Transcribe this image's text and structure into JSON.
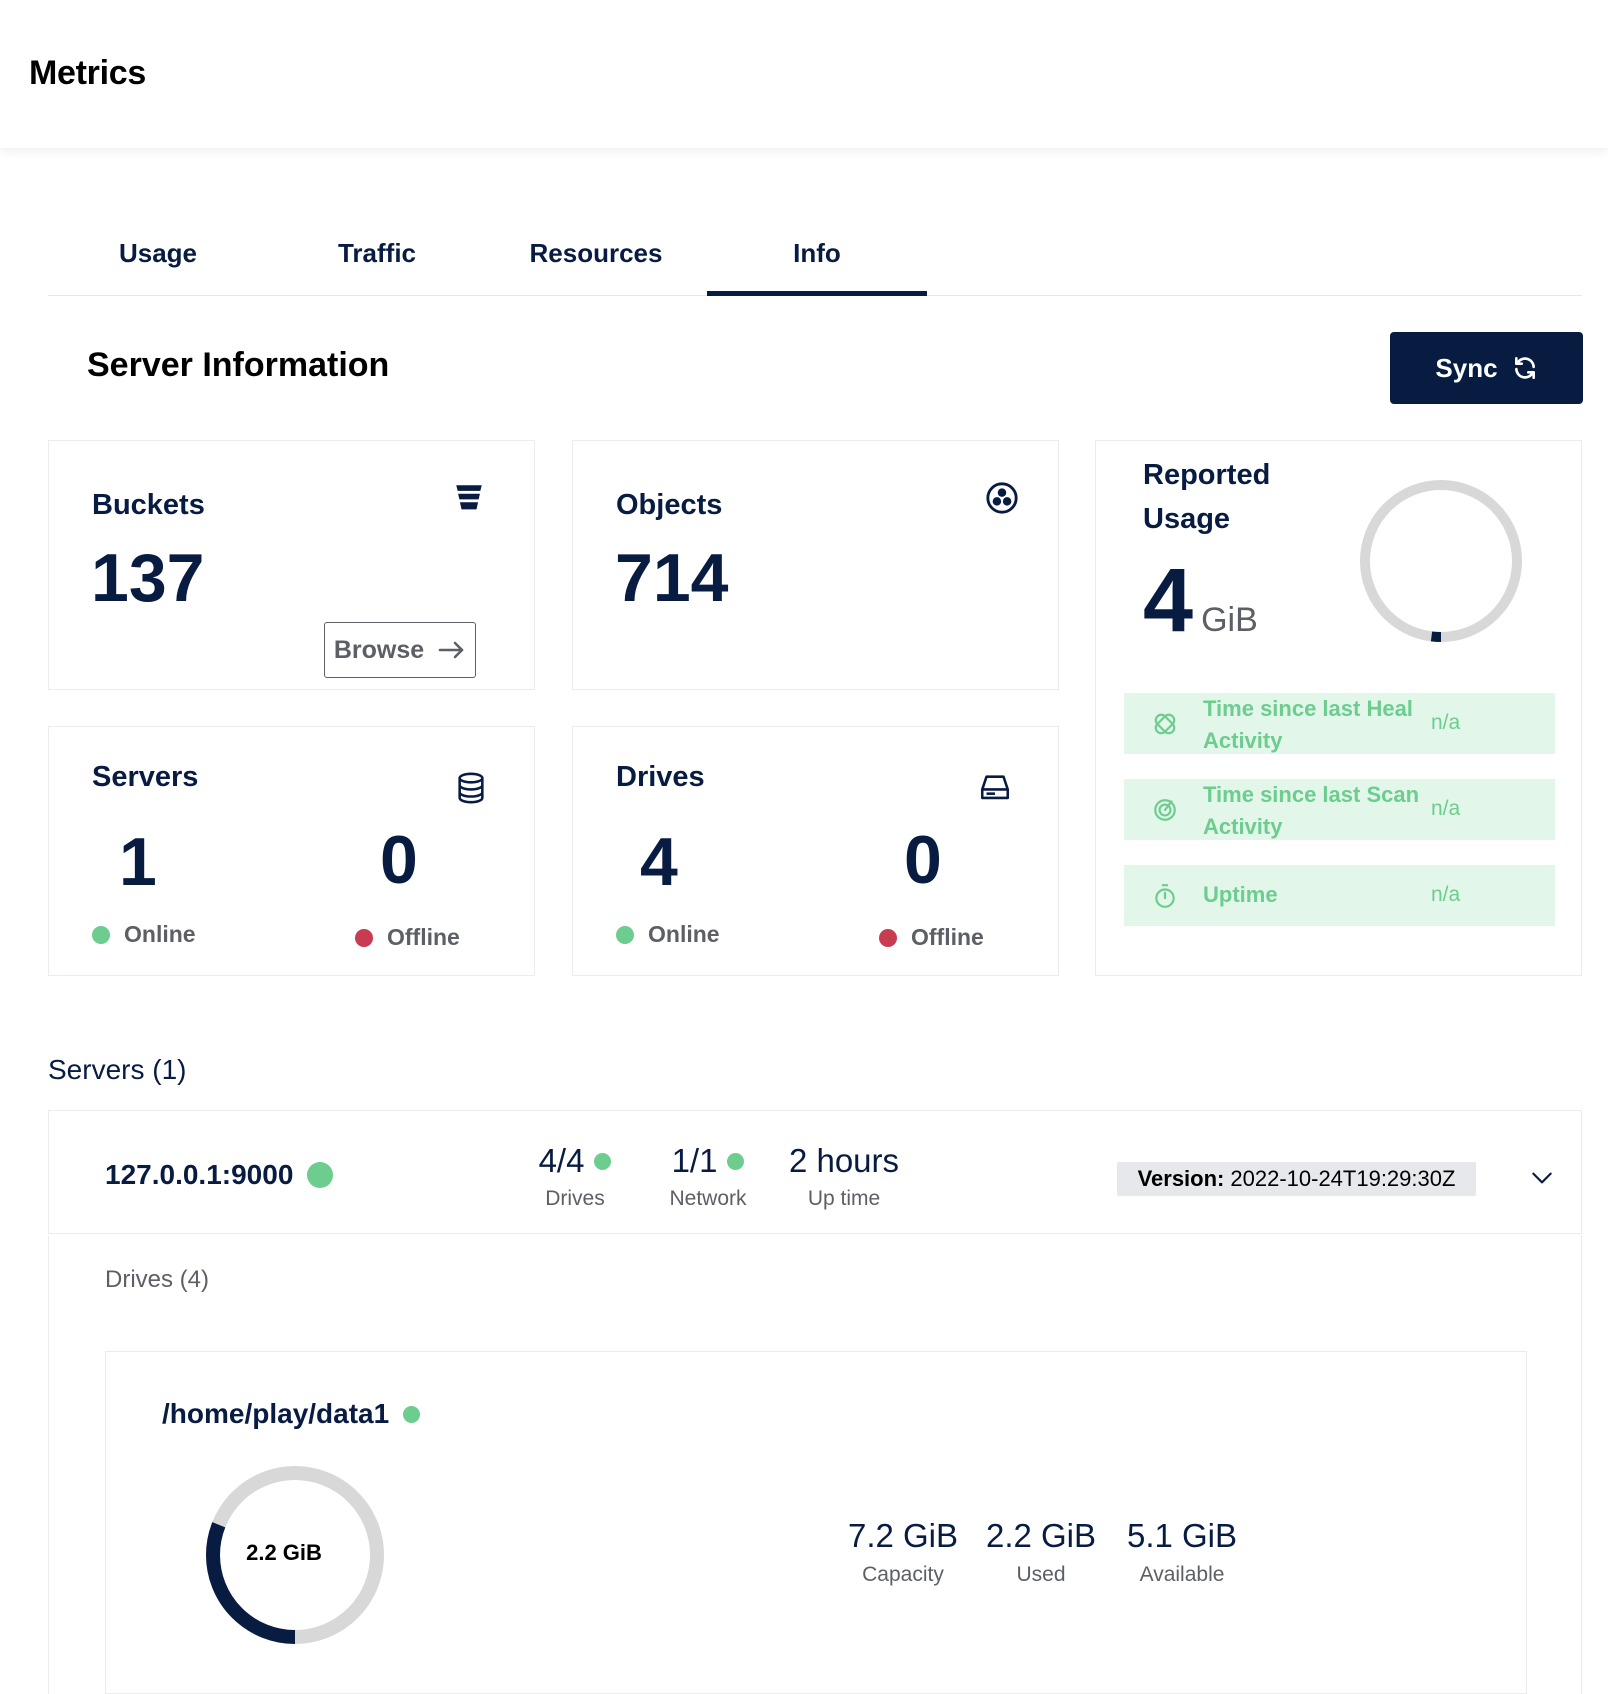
{
  "header": {
    "title": "Metrics"
  },
  "tabs": [
    {
      "label": "Usage"
    },
    {
      "label": "Traffic"
    },
    {
      "label": "Resources"
    },
    {
      "label": "Info",
      "active": true
    }
  ],
  "section": {
    "title": "Server Information",
    "sync_label": "Sync"
  },
  "cards": {
    "buckets": {
      "title": "Buckets",
      "value": "137",
      "browse_label": "Browse",
      "icon": "bucket-icon"
    },
    "objects": {
      "title": "Objects",
      "value": "714",
      "icon": "objects-icon"
    },
    "servers": {
      "title": "Servers",
      "online": "1",
      "offline": "0",
      "online_label": "Online",
      "offline_label": "Offline",
      "icon": "servers-icon"
    },
    "drives": {
      "title": "Drives",
      "online": "4",
      "offline": "0",
      "online_label": "Online",
      "offline_label": "Offline",
      "icon": "drive-icon"
    },
    "usage": {
      "title_line1": "Reported",
      "title_line2": "Usage",
      "value": "4",
      "unit": "GiB",
      "ring_fill_fraction": 0.02
    }
  },
  "health": [
    {
      "label_line1": "Time since last Heal",
      "label_line2": "Activity",
      "value": "n/a",
      "icon": "heal-icon"
    },
    {
      "label_line1": "Time since last Scan",
      "label_line2": "Activity",
      "value": "n/a",
      "icon": "scan-icon"
    },
    {
      "label_line1": "Uptime",
      "value": "n/a",
      "icon": "stopwatch-icon"
    }
  ],
  "servers_list": {
    "heading": "Servers (1)",
    "server": {
      "endpoint": "127.0.0.1:9000",
      "drives_value": "4/4",
      "drives_label": "Drives",
      "network_value": "1/1",
      "network_label": "Network",
      "uptime_value": "2 hours",
      "uptime_label": "Up time",
      "version_key": "Version:",
      "version_value": "2022-10-24T19:29:30Z"
    }
  },
  "drives_list": {
    "heading": "Drives (4)",
    "drive": {
      "path": "/home/play/data1",
      "ring_label": "2.2 GiB",
      "used_fraction": 0.31,
      "capacity_value": "7.2 GiB",
      "capacity_label": "Capacity",
      "used_value": "2.2 GiB",
      "used_label": "Used",
      "available_value": "5.1 GiB",
      "available_label": "Available"
    }
  },
  "colors": {
    "primary": "#081c42",
    "online": "#6ccd8f",
    "offline": "#c83b51",
    "health_bg": "#e2f6ea",
    "ring_track": "#d8d8d8"
  }
}
